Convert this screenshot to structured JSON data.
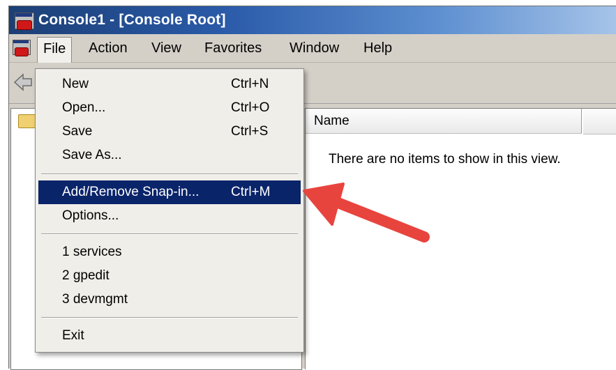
{
  "window": {
    "title": "Console1 - [Console Root]"
  },
  "menubar": {
    "items": [
      {
        "label": "File",
        "active": true
      },
      {
        "label": "Action"
      },
      {
        "label": "View"
      },
      {
        "label": "Favorites"
      },
      {
        "label": "Window"
      },
      {
        "label": "Help"
      }
    ]
  },
  "file_menu": {
    "new": {
      "label": "New",
      "shortcut": "Ctrl+N"
    },
    "open": {
      "label": "Open...",
      "shortcut": "Ctrl+O"
    },
    "save": {
      "label": "Save",
      "shortcut": "Ctrl+S"
    },
    "save_as": {
      "label": "Save As..."
    },
    "add_remove": {
      "label": "Add/Remove Snap-in...",
      "shortcut": "Ctrl+M",
      "highlighted": true
    },
    "options": {
      "label": "Options..."
    },
    "recent": [
      "1 services",
      "2 gpedit",
      "3 devmgmt"
    ],
    "exit": {
      "label": "Exit"
    }
  },
  "list_view": {
    "column_name": "Name",
    "empty_message": "There are no items to show in this view."
  },
  "colors": {
    "highlight": "#0a246a",
    "arrow": "#e8443e",
    "titlebar_start": "#1c3f75"
  },
  "icons": [
    "mmc-console-icon",
    "back-arrow-icon",
    "folder-icon",
    "annotation-arrow"
  ]
}
